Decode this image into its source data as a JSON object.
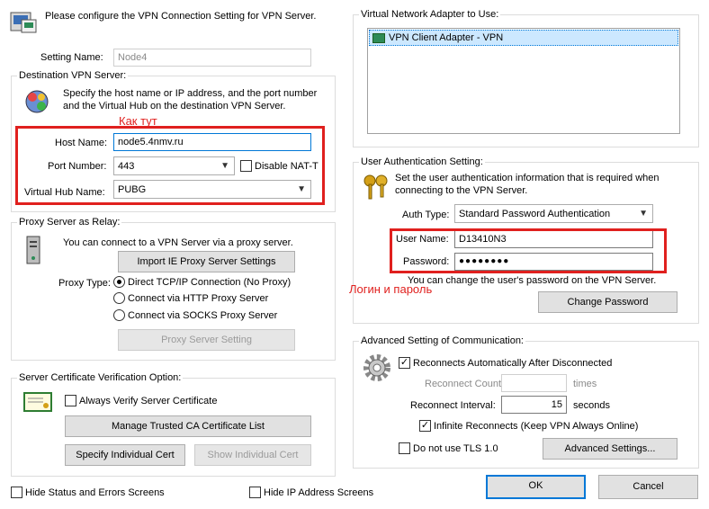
{
  "header": {
    "instruction": "Please configure the VPN Connection Setting for VPN Server."
  },
  "setting_name": {
    "label": "Setting Name:",
    "value": "Node4"
  },
  "destination": {
    "group_title": "Destination VPN Server:",
    "description": "Specify the host name or IP address, and the port number and the Virtual Hub on the destination VPN Server.",
    "host_label": "Host Name:",
    "host_value": "node5.4nmv.ru",
    "port_label": "Port Number:",
    "port_value": "443",
    "disable_nat_label": "Disable NAT-T",
    "hub_label": "Virtual Hub Name:",
    "hub_value": "PUBG"
  },
  "proxy": {
    "group_title": "Proxy Server as Relay:",
    "description": "You can connect to a VPN Server via a proxy server.",
    "import_button": "Import IE Proxy Server Settings",
    "type_label": "Proxy Type:",
    "options": [
      "Direct TCP/IP Connection (No Proxy)",
      "Connect via HTTP Proxy Server",
      "Connect via SOCKS Proxy Server"
    ],
    "setting_button": "Proxy Server Setting"
  },
  "cert": {
    "group_title": "Server Certificate Verification Option:",
    "always_verify_label": "Always Verify Server Certificate",
    "manage_button": "Manage Trusted CA Certificate List",
    "specify_button": "Specify Individual Cert",
    "show_button": "Show Individual Cert"
  },
  "bottom": {
    "hide_status_label": "Hide Status and Errors Screens",
    "hide_ip_label": "Hide IP Address Screens",
    "ok_button": "OK",
    "cancel_button": "Cancel"
  },
  "adapter": {
    "group_title": "Virtual Network Adapter to Use:",
    "items": [
      "VPN Client Adapter - VPN"
    ]
  },
  "auth": {
    "group_title": "User Authentication Setting:",
    "description": "Set the user authentication information that is required when connecting to the VPN Server.",
    "type_label": "Auth Type:",
    "type_value": "Standard Password Authentication",
    "user_label": "User Name:",
    "user_value": "D13410N3",
    "password_label": "Password:",
    "password_value": "●●●●●●●●",
    "change_note": "You can change the user's password on the VPN Server.",
    "change_button": "Change Password"
  },
  "advanced": {
    "group_title": "Advanced Setting of Communication:",
    "reconnect_auto_label": "Reconnects Automatically After Disconnected",
    "reconnect_count_label": "Reconnect Count:",
    "reconnect_count_value": "",
    "times_label": "times",
    "reconnect_interval_label": "Reconnect Interval:",
    "reconnect_interval_value": "15",
    "seconds_label": "seconds",
    "infinite_label": "Infinite Reconnects (Keep VPN Always Online)",
    "no_tls_label": "Do not use TLS 1.0",
    "advanced_button": "Advanced Settings..."
  },
  "annotations": {
    "here": "Как тут",
    "login": "Логин и пароль"
  },
  "colors": {
    "annotation": "#e0201e",
    "selection": "#0078d7"
  }
}
